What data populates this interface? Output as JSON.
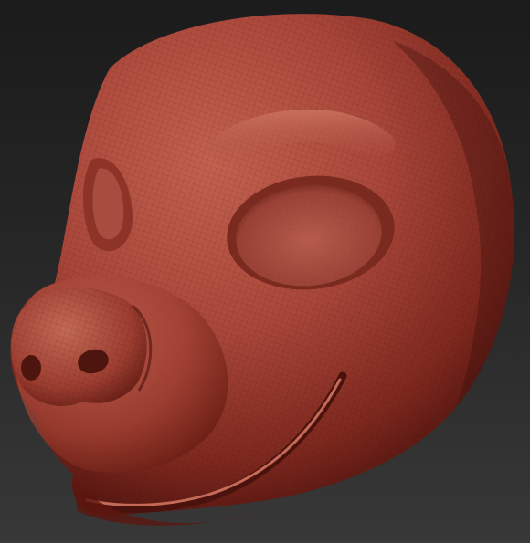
{
  "scene": {
    "subject": "sculpted-animal-head",
    "background_top": "#1b1b1b",
    "background_bottom": "#383838",
    "material_light": "#c76b58",
    "material_mid": "#a64434",
    "material_dark": "#6a1f16",
    "material_shadow": "#3a0f0b"
  }
}
